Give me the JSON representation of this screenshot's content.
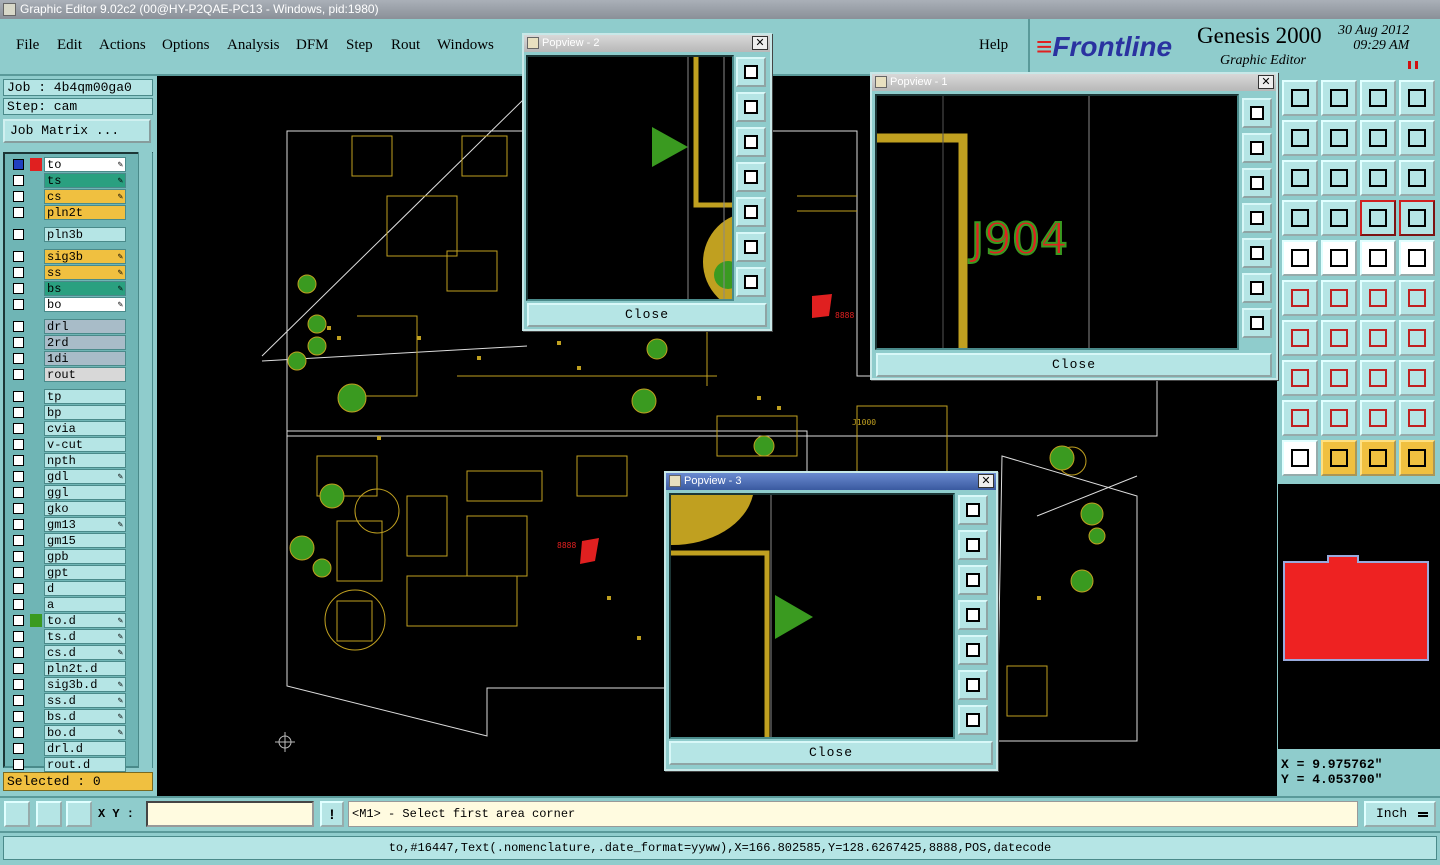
{
  "window": {
    "title": "Graphic Editor 9.02c2 (00@HY-P2QAE-PC13 - Windows, pid:1980)"
  },
  "menu": {
    "items": [
      "File",
      "Edit",
      "Actions",
      "Options",
      "Analysis",
      "DFM",
      "Step",
      "Rout",
      "Windows"
    ],
    "help": "Help"
  },
  "brand": {
    "logo": "Frontline",
    "product": "Genesis 2000",
    "subtitle": "Graphic Editor",
    "date": "30 Aug 2012",
    "time": "09:29 AM"
  },
  "job": {
    "job_line": "Job : 4b4qm00ga0",
    "step_line": "Step: cam",
    "matrix_button": "Job Matrix ..."
  },
  "layers": [
    {
      "name": "to",
      "color": "#ffffff",
      "mark": "#e02020",
      "sel": true,
      "edit": true
    },
    {
      "name": "ts",
      "color": "#2aa080",
      "edit": true
    },
    {
      "name": "cs",
      "color": "#f0c040",
      "edit": true
    },
    {
      "name": "pln2t",
      "color": "#f0c040"
    },
    {
      "name": "pln3b",
      "color": "#b5e5e5",
      "gap": true
    },
    {
      "name": "sig3b",
      "color": "#f0c040",
      "edit": true,
      "gap": true
    },
    {
      "name": "ss",
      "color": "#f0c040",
      "edit": true
    },
    {
      "name": "bs",
      "color": "#2aa080",
      "edit": true
    },
    {
      "name": "bo",
      "color": "#ffffff",
      "edit": true
    },
    {
      "name": "drl",
      "color": "#a8bcc8",
      "gap": true
    },
    {
      "name": "2rd",
      "color": "#a8bcc8"
    },
    {
      "name": "1di",
      "color": "#a8bcc8"
    },
    {
      "name": "rout",
      "color": "#d8d8d8"
    },
    {
      "name": "tp",
      "color": "#b5e5e5",
      "gap": true
    },
    {
      "name": "bp",
      "color": "#b5e5e5"
    },
    {
      "name": "cvia",
      "color": "#b5e5e5"
    },
    {
      "name": "v-cut",
      "color": "#b5e5e5"
    },
    {
      "name": "npth",
      "color": "#b5e5e5"
    },
    {
      "name": "gdl",
      "color": "#b5e5e5",
      "edit": true
    },
    {
      "name": "ggl",
      "color": "#b5e5e5"
    },
    {
      "name": "gko",
      "color": "#b5e5e5"
    },
    {
      "name": "gm13",
      "color": "#b5e5e5",
      "edit": true
    },
    {
      "name": "gm15",
      "color": "#b5e5e5"
    },
    {
      "name": "gpb",
      "color": "#b5e5e5"
    },
    {
      "name": "gpt",
      "color": "#b5e5e5"
    },
    {
      "name": "d",
      "color": "#b5e5e5"
    },
    {
      "name": "a",
      "color": "#b5e5e5"
    },
    {
      "name": "to.d",
      "color": "#b5e5e5",
      "mark": "#3a9a20",
      "edit": true
    },
    {
      "name": "ts.d",
      "color": "#b5e5e5",
      "edit": true
    },
    {
      "name": "cs.d",
      "color": "#b5e5e5",
      "edit": true
    },
    {
      "name": "pln2t.d",
      "color": "#b5e5e5"
    },
    {
      "name": "sig3b.d",
      "color": "#b5e5e5",
      "edit": true
    },
    {
      "name": "ss.d",
      "color": "#b5e5e5",
      "edit": true
    },
    {
      "name": "bs.d",
      "color": "#b5e5e5",
      "edit": true
    },
    {
      "name": "bo.d",
      "color": "#b5e5e5",
      "edit": true
    },
    {
      "name": "drl.d",
      "color": "#b5e5e5"
    },
    {
      "name": "rout.d",
      "color": "#b5e5e5"
    }
  ],
  "selected": "Selected : 0",
  "popviews": {
    "p2": {
      "title": "Popview - 2",
      "close": "Close"
    },
    "p1": {
      "title": "Popview - 1",
      "close": "Close",
      "label": "J904"
    },
    "p3": {
      "title": "Popview - 3",
      "close": "Close"
    }
  },
  "board_labels": {
    "mark1": "J1000",
    "mark2": "8888"
  },
  "coords": {
    "x_line": "X = 9.975762\"",
    "y_line": "Y = 4.053700\""
  },
  "bottom": {
    "xy_label": "X Y :",
    "xy_value": "",
    "bang": "!",
    "prompt": "<M1> - Select first area corner",
    "unit": "Inch"
  },
  "status": "to,#16447,Text(.nomenclature,.date_format=yyww),X=166.802585,Y=128.6267425,8888,POS,datecode",
  "colors": {
    "panel": "#8fcccc",
    "board_trace": "#c0a020",
    "pad_green": "#3a9a20",
    "text_red": "#e02020"
  }
}
